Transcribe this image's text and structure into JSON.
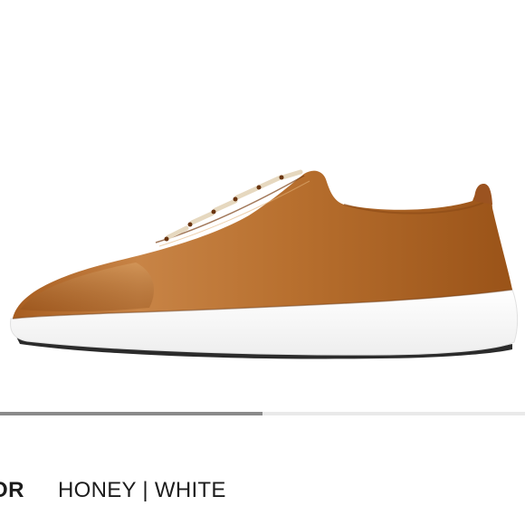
{
  "product": {
    "image_subject": "shoe-side-view",
    "colors": {
      "leather": "#b36a2c",
      "leather_light": "#d49a5e",
      "leather_dark": "#7a3f14",
      "sole": "#ffffff",
      "lace": "#e6d8bf"
    }
  },
  "gallery": {
    "progress_fraction": 0.5
  },
  "color_selector": {
    "label": "OR",
    "value": "HONEY | WHITE"
  }
}
